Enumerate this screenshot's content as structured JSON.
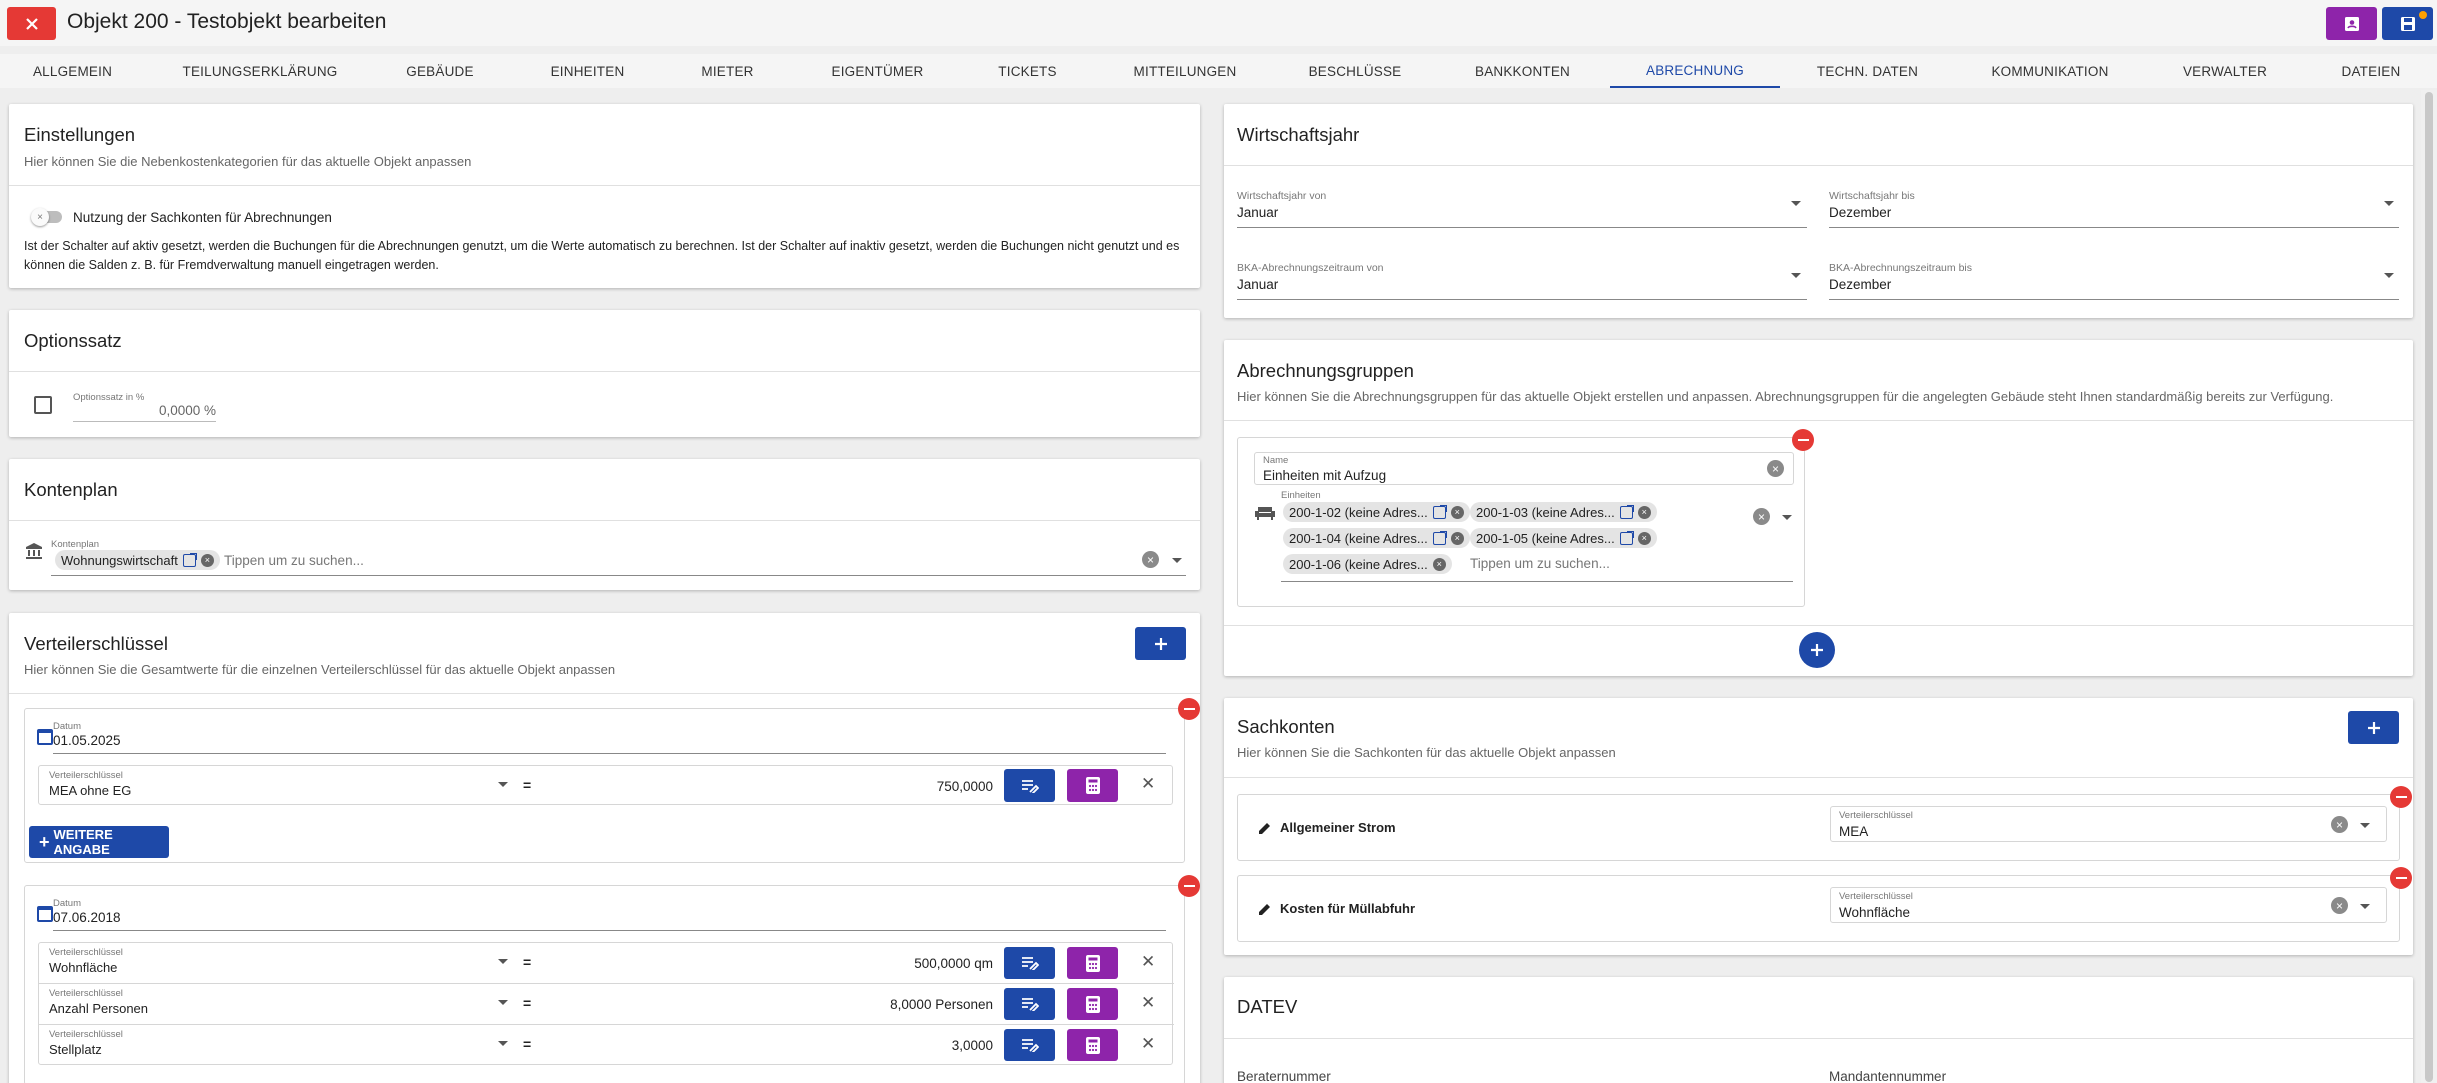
{
  "header": {
    "title": "Objekt 200 - Testobjekt bearbeiten",
    "close_icon": "close-icon",
    "colors": {
      "close": "#e53935",
      "action": "#8e24aa",
      "accent": "#1e49a8"
    }
  },
  "tabs": [
    "ALLGEMEIN",
    "TEILUNGSERKLÄRUNG",
    "GEBÄUDE",
    "EINHEITEN",
    "MIETER",
    "EIGENTÜMER",
    "TICKETS",
    "MITTEILUNGEN",
    "BESCHLÜSSE",
    "BANKKONTEN",
    "ABRECHNUNG",
    "TECHN. DATEN",
    "KOMMUNIKATION",
    "VERWALTER",
    "DATEIEN"
  ],
  "active_tab": "ABRECHNUNG",
  "einstellungen": {
    "title": "Einstellungen",
    "subtitle": "Hier können Sie die Nebenkostenkategorien für das aktuelle Objekt anpassen",
    "toggle_label": "Nutzung der Sachkonten für Abrechnungen",
    "description": "Ist der Schalter auf aktiv gesetzt, werden die Buchungen für die Abrechnungen genutzt, um die Werte automatisch zu berechnen. Ist der Schalter auf inaktiv gesetzt, werden die Buchungen nicht genutzt und es können die Salden z. B. für Fremdverwaltung manuell eingetragen werden."
  },
  "optionssatz": {
    "title": "Optionssatz",
    "field_label": "Optionssatz in %",
    "field_value": "0,0000 %"
  },
  "kontenplan": {
    "title": "Kontenplan",
    "field_label": "Kontenplan",
    "chip": "Wohnungswirtschaft",
    "placeholder": "Tippen um zu suchen..."
  },
  "verteilerschluessel": {
    "title": "Verteilerschlüssel",
    "subtitle": "Hier können Sie die Gesamtwerte für die einzelnen Verteilerschlüssel für das aktuelle Objekt anpassen",
    "datum_label": "Datum",
    "vs_label": "Verteilerschlüssel",
    "equals": "=",
    "add_more_label": "WEITERE ANGABE",
    "groups": [
      {
        "datum": "01.05.2025",
        "rows": [
          {
            "name": "MEA ohne EG",
            "value": "750,0000"
          }
        ]
      },
      {
        "datum": "07.06.2018",
        "rows": [
          {
            "name": "Wohnfläche",
            "value": "500,0000 qm"
          },
          {
            "name": "Anzahl Personen",
            "value": "8,0000 Personen"
          },
          {
            "name": "Stellplatz",
            "value": "3,0000"
          }
        ]
      }
    ]
  },
  "wirtschaftsjahr": {
    "title": "Wirtschaftsjahr",
    "von_label": "Wirtschaftsjahr von",
    "von_value": "Januar",
    "bis_label": "Wirtschaftsjahr bis",
    "bis_value": "Dezember",
    "bka_von_label": "BKA-Abrechnungszeitraum von",
    "bka_von_value": "Januar",
    "bka_bis_label": "BKA-Abrechnungszeitraum bis",
    "bka_bis_value": "Dezember"
  },
  "abrechnungsgruppen": {
    "title": "Abrechnungsgruppen",
    "subtitle": "Hier können Sie die Abrechnungsgruppen für das aktuelle Objekt erstellen und anpassen. Abrechnungsgruppen für die angelegten Gebäude steht Ihnen standardmäßig bereits zur Verfügung.",
    "name_label": "Name",
    "name_value": "Einheiten mit Aufzug",
    "einheiten_label": "Einheiten",
    "chips": [
      "200-1-02 (keine Adres...",
      "200-1-03 (keine Adres...",
      "200-1-04 (keine Adres...",
      "200-1-05 (keine Adres...",
      "200-1-06 (keine Adres..."
    ],
    "placeholder": "Tippen um zu suchen..."
  },
  "sachkonten": {
    "title": "Sachkonten",
    "subtitle": "Hier können Sie die Sachkonten für das aktuelle Objekt anpassen",
    "vs_label": "Verteilerschlüssel",
    "items": [
      {
        "name": "Allgemeiner Strom",
        "vs": "MEA"
      },
      {
        "name": "Kosten für Müllabfuhr",
        "vs": "Wohnfläche"
      }
    ]
  },
  "datev": {
    "title": "DATEV",
    "berater_label": "Beraternummer",
    "mandanten_label": "Mandantennummer"
  }
}
